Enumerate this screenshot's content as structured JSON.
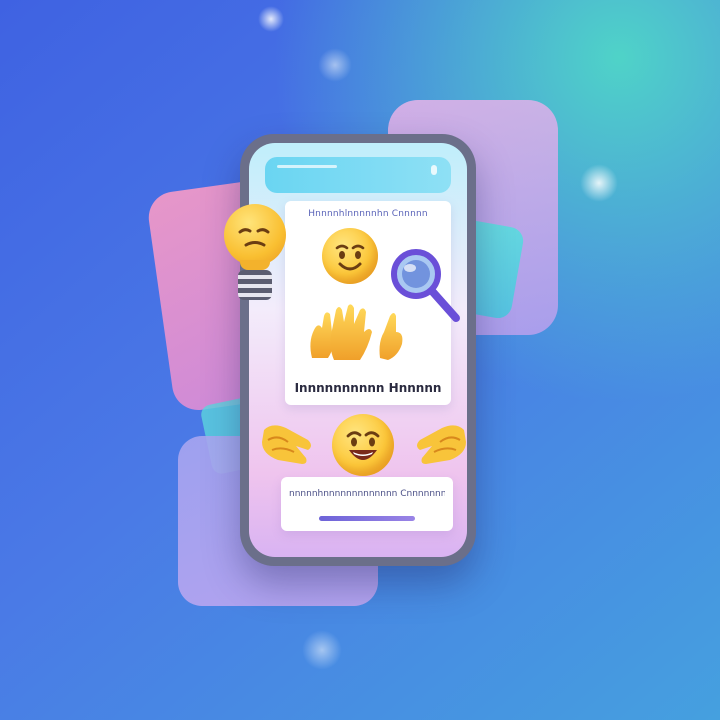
{
  "screen": {
    "header_text": "Hnnnnhlnnnnnhn Cnnnnn",
    "caption_text": "Innnnnnnnnn Hnnnnn",
    "input_text": "nnnnnhnnnnnnnnnnnnn Cnnnnnnn"
  },
  "icons": {
    "bulb": "lightbulb-emoji-icon",
    "smile": "smiling-face-icon",
    "magnifier": "magnifying-glass-icon",
    "hands": "raised-hands-icon",
    "grin": "grinning-face-icon",
    "clap_left": "clapping-hands-icon",
    "clap_right": "clapping-hands-icon"
  },
  "colors": {
    "background_start": "#3f62e2",
    "background_end": "#45a0df",
    "accent_pink": "#f59ac6",
    "accent_lilac": "#b9a0ee",
    "accent_teal": "#5ee1de",
    "emoji_yellow": "#fcc83a",
    "magnifier_purple": "#6a4fd8"
  }
}
